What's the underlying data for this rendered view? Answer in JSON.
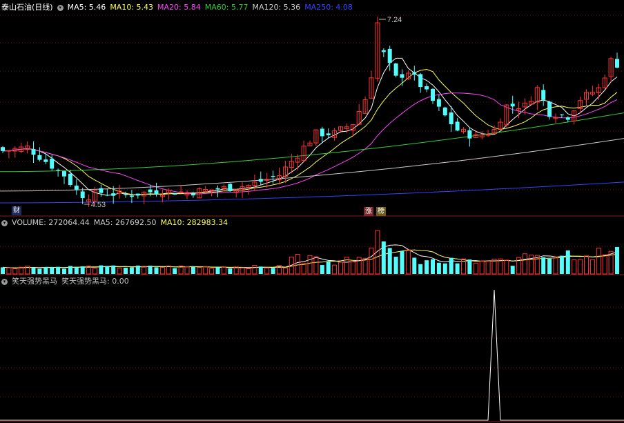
{
  "price_panel": {
    "title": "泰山石油(日线)",
    "indicators": [
      {
        "label": "MA5: 5.46",
        "color": "#ffffff"
      },
      {
        "label": "MA10: 5.43",
        "color": "#ffff55"
      },
      {
        "label": "MA20: 5.84",
        "color": "#ff44ff"
      },
      {
        "label": "MA60: 5.77",
        "color": "#33cc33"
      },
      {
        "label": "MA120: 5.36",
        "color": "#cccccc"
      },
      {
        "label": "MA250: 4.08",
        "color": "#3344ff"
      }
    ],
    "high_label": "7.24",
    "low_label": "4.53",
    "tag_cai": "财",
    "tag_zhang": "涨",
    "tag_bang": "榜"
  },
  "volume_panel": {
    "indicators": [
      {
        "label": "VOLUME: 272064.44",
        "color": "#cccccc"
      },
      {
        "label": "MA5: 267692.50",
        "color": "#cccccc"
      },
      {
        "label": "MA10: 282983.34",
        "color": "#ffff55"
      }
    ]
  },
  "indicator_panel": {
    "title": "笑天强势黑马",
    "value_label": "笑天强势黑马: 0.00"
  },
  "colors": {
    "up": "#ff3333",
    "down": "#54fcfc",
    "grid": "#7a1414",
    "panel_border": "#8b1a1a"
  },
  "chart_data": {
    "type": "candlestick",
    "high": 7.24,
    "low": 4.53,
    "indicator_peak_value": 1
  }
}
